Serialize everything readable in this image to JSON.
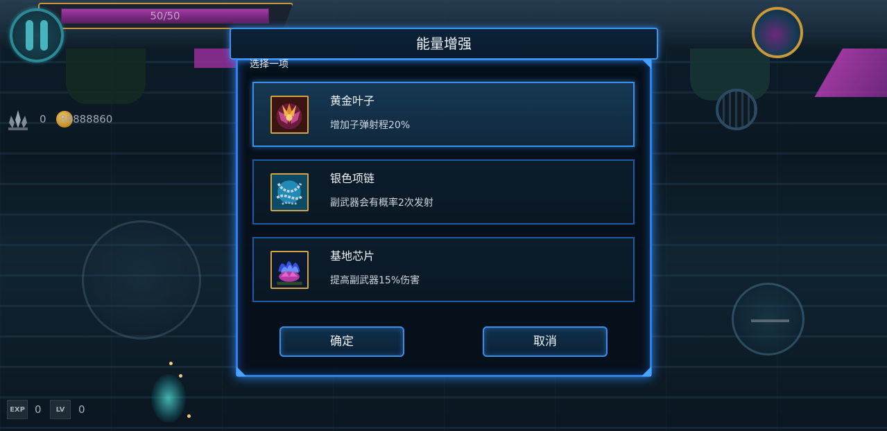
{
  "hud": {
    "hp_text": "50/50",
    "hp_fraction": 1.0,
    "crystal_count": "0",
    "coin_count": "88888860",
    "exp_label": "EXP",
    "exp_value": "0",
    "lv_label": "LV",
    "lv_value": "0"
  },
  "dialog": {
    "title": "能量增强",
    "subtitle": "选择一项",
    "options": [
      {
        "name": "黄金叶子",
        "desc": "增加子弹射程20%",
        "icon": "golden-leaf-icon",
        "selected": true
      },
      {
        "name": "银色项链",
        "desc": "副武器会有概率2次发射",
        "icon": "silver-necklace-icon",
        "selected": false
      },
      {
        "name": "基地芯片",
        "desc": "提高副武器15%伤害",
        "icon": "base-chip-icon",
        "selected": false
      }
    ],
    "confirm_label": "确定",
    "cancel_label": "取消"
  },
  "colors": {
    "accent_blue": "#3d8fe8",
    "hp_purple": "#a13ea6",
    "gold_frame": "#c9973a"
  }
}
